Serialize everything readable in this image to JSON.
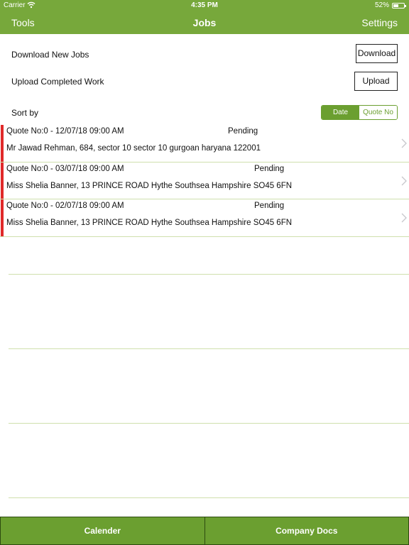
{
  "status_bar": {
    "carrier": "Carrier",
    "time": "4:35 PM",
    "battery": "52%",
    "battery_level": 0.52
  },
  "nav": {
    "left": "Tools",
    "title": "Jobs",
    "right": "Settings"
  },
  "actions": {
    "download_label": "Download New Jobs",
    "download_button": "Download",
    "upload_label": "Upload Completed Work",
    "upload_button": "Upload"
  },
  "sort": {
    "label": "Sort by",
    "options": [
      "Date",
      "Quote No"
    ],
    "selected": "Date"
  },
  "jobs": [
    {
      "quote": "Quote No:0 - 12/07/18 09:00 AM",
      "status": "Pending",
      "address": "Mr Jawad Rehman, 684, sector 10 sector 10 gurgoan haryana 122001"
    },
    {
      "quote": "Quote No:0 - 03/07/18 09:00 AM",
      "status": "Pending",
      "address": "Miss Shelia Banner, 13 PRINCE ROAD Hythe Southsea Hampshire SO45 6FN"
    },
    {
      "quote": "Quote No:0 - 02/07/18 09:00 AM",
      "status": "Pending",
      "address": "Miss Shelia Banner, 13 PRINCE ROAD Hythe Southsea Hampshire SO45 6FN"
    }
  ],
  "tabs": [
    "Calender",
    "Company Docs"
  ],
  "colors": {
    "brand_green": "#77a83b",
    "tab_green": "#6b9f30",
    "marker_red": "#e02929"
  }
}
